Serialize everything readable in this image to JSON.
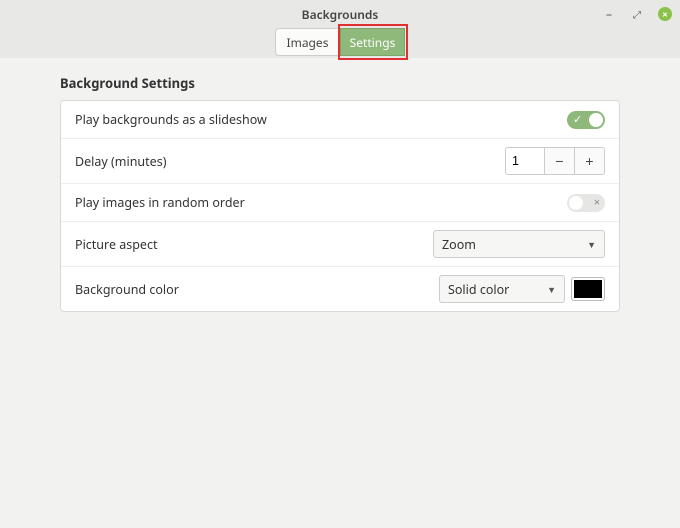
{
  "window": {
    "title": "Backgrounds"
  },
  "tabs": {
    "images": "Images",
    "settings": "Settings"
  },
  "section": {
    "title": "Background Settings"
  },
  "rows": {
    "slideshow": {
      "label": "Play backgrounds as a slideshow",
      "enabled": true
    },
    "delay": {
      "label": "Delay (minutes)",
      "value": "1"
    },
    "random": {
      "label": "Play images in random order",
      "enabled": false
    },
    "aspect": {
      "label": "Picture aspect",
      "value": "Zoom"
    },
    "bgcolor": {
      "label": "Background color",
      "mode": "Solid color",
      "color": "#000000"
    }
  }
}
